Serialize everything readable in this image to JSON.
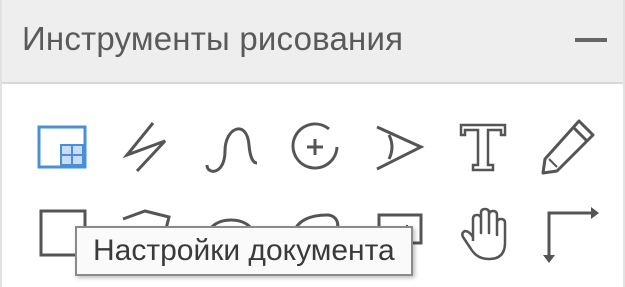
{
  "panel": {
    "title": "Инструменты рисования",
    "collapse_icon": "minus-icon"
  },
  "tools": {
    "row1": [
      "document-settings-icon",
      "zigzag-line-icon",
      "curve-icon",
      "circle-plus-icon",
      "angle-icon",
      "text-icon",
      "pencil-icon"
    ],
    "row2": [
      "rectangle-icon",
      "polygon-icon",
      "ellipse-icon",
      "freeform-shape-icon",
      "box-icon",
      "hand-pan-icon",
      "right-angle-arrow-icon"
    ]
  },
  "tooltip": {
    "text": "Настройки документа"
  },
  "colors": {
    "accent": "#4a90d9",
    "icon": "#555555"
  }
}
